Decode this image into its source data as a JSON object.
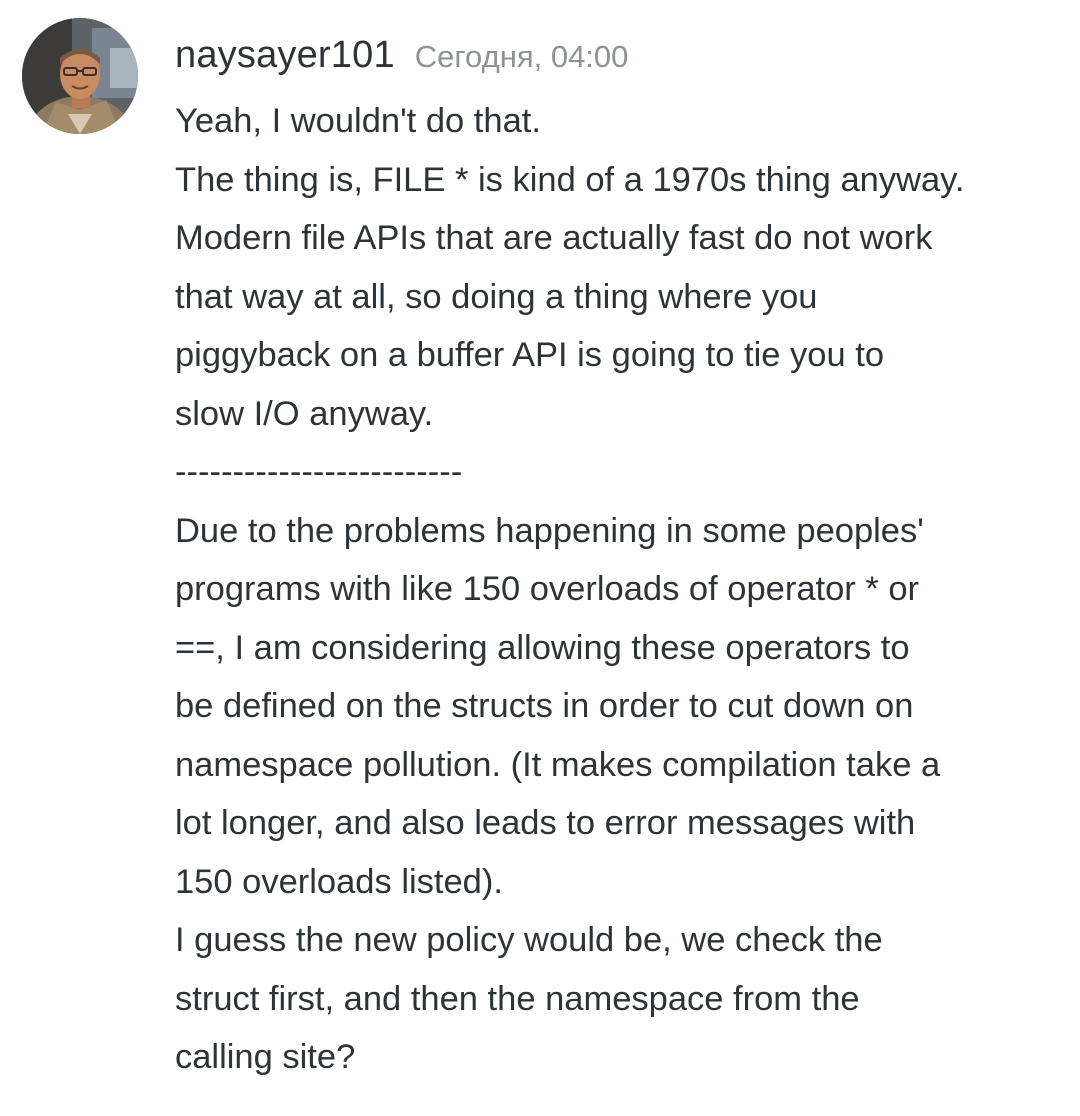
{
  "message": {
    "author": "naysayer101",
    "timestamp": "Сегодня, 04:00",
    "lines": [
      "Yeah, I wouldn't do that.",
      "The thing is, FILE * is kind of a 1970s thing anyway.",
      "Modern file APIs that are actually fast do not work",
      "that way at all, so doing a thing where you",
      "piggyback on a buffer API is going to tie you to",
      "slow I/O anyway.",
      "-------------------------",
      "Due to the problems happening in some peoples'",
      "programs with like 150 overloads of operator * or",
      "==, I am considering allowing these operators to",
      "be defined on the structs in order to cut down on",
      "namespace pollution. (It makes compilation take a",
      "lot longer, and also leads to error messages with",
      "150 overloads listed).",
      "I guess the new policy would be, we check the",
      "struct first, and then the namespace from the",
      "calling site?"
    ]
  },
  "colors": {
    "text": "#2e3338",
    "timestamp": "#8e9297",
    "background": "#ffffff"
  },
  "icons": {
    "avatar": "user-avatar-photo"
  }
}
